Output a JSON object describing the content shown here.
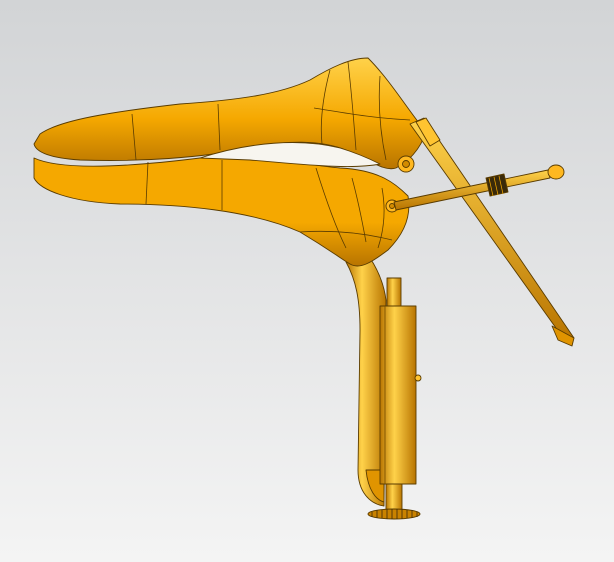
{
  "viewport": {
    "background_top": "#d2d4d6",
    "background_bottom": "#f4f4f4"
  },
  "model": {
    "object": "speculum-cad-model",
    "body_color": "#f5a800",
    "highlight_color": "#ffd24a",
    "shadow_color": "#b87400",
    "edge_color": "#5a3c00",
    "knurl_color": "#3a2a0a"
  }
}
